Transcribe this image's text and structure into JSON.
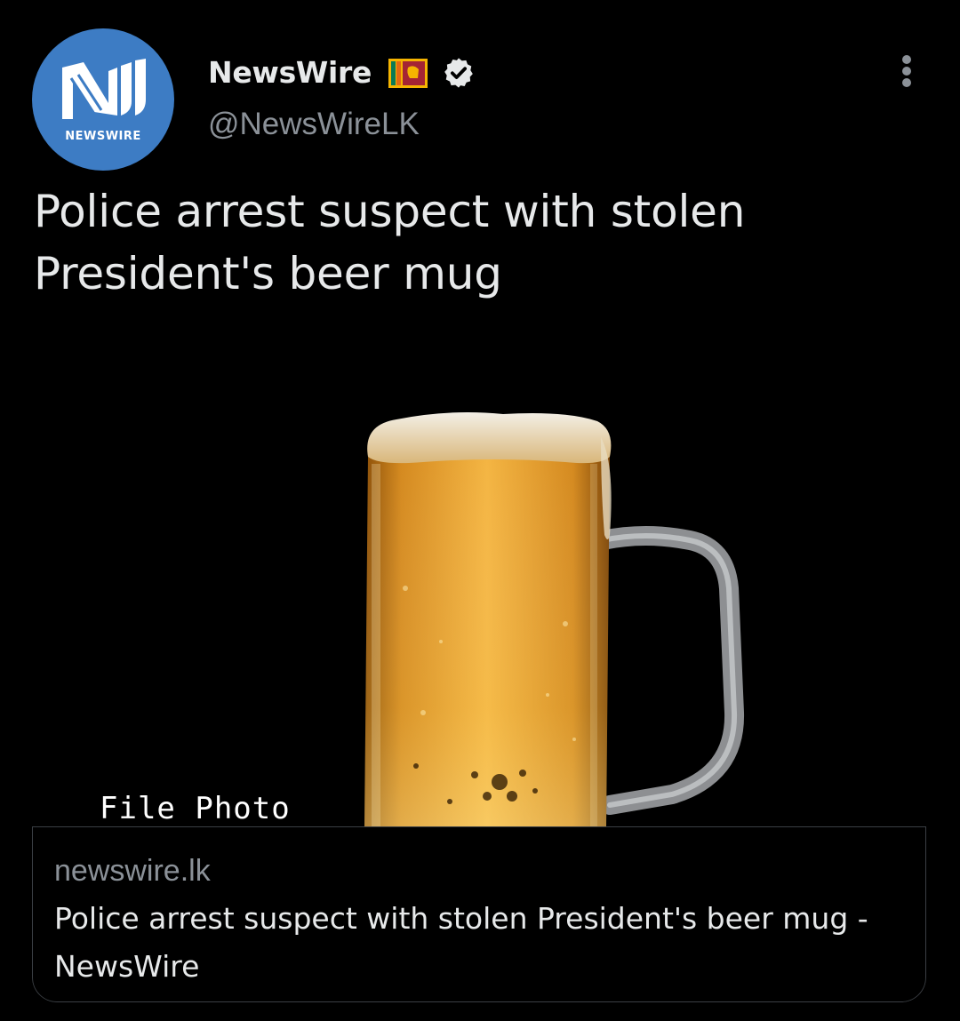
{
  "author": {
    "avatar_text": "NEWSWIRE",
    "display_name": "NewsWire",
    "handle": "@NewsWireLK",
    "flag_icon": "sri-lanka-flag-icon",
    "verified_icon": "verified-badge-icon",
    "more_icon": "more-options-icon"
  },
  "tweet": {
    "text": "Police arrest suspect with stolen President's beer mug"
  },
  "card": {
    "image_caption": "File Photo",
    "domain": "newswire.lk",
    "title": "Police arrest suspect with stolen President's beer mug - NewsWire"
  },
  "colors": {
    "background": "#000000",
    "avatar_blue": "#3d7cc4",
    "primary_text": "#e7e9ea",
    "secondary_text": "#8b9198"
  }
}
